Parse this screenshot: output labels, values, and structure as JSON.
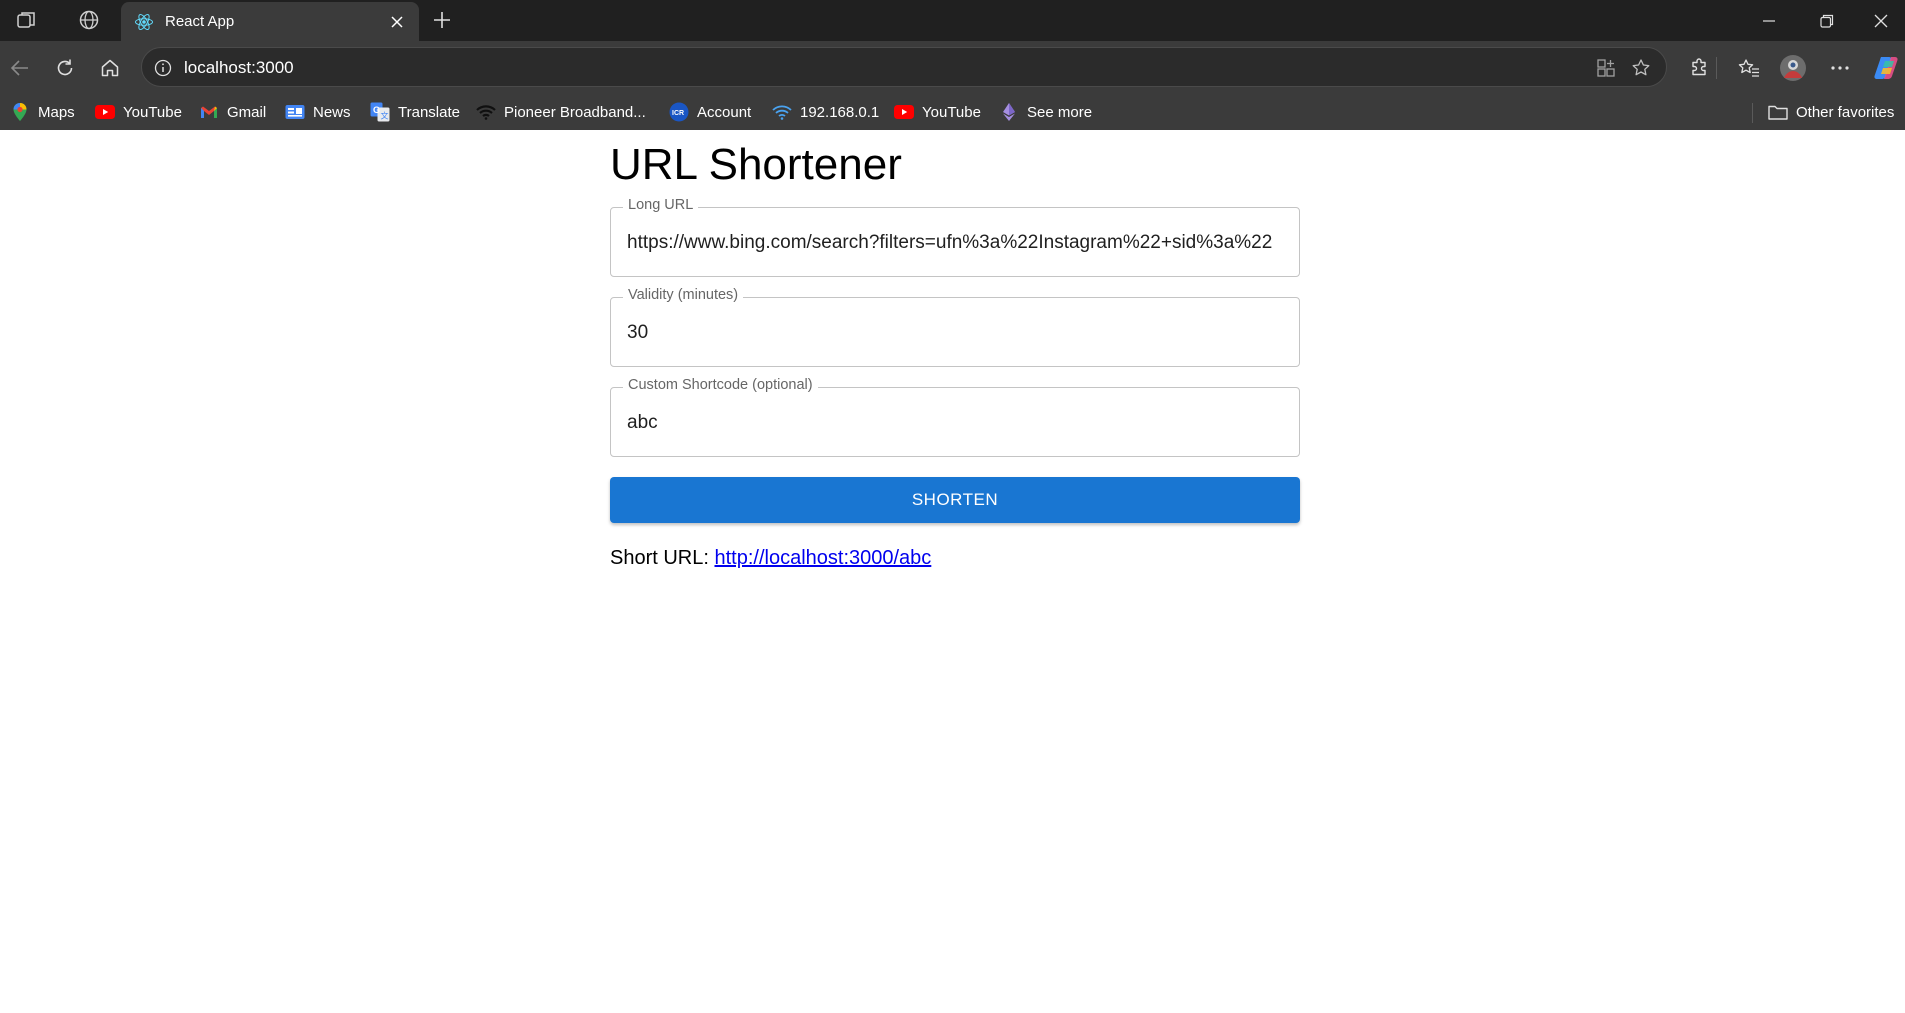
{
  "browser": {
    "tab_title": "React App",
    "address": "localhost:3000",
    "favorites": [
      {
        "label": "Maps",
        "icon": "maps-pin-icon"
      },
      {
        "label": "YouTube",
        "icon": "youtube-icon"
      },
      {
        "label": "Gmail",
        "icon": "gmail-icon"
      },
      {
        "label": "News",
        "icon": "google-news-icon"
      },
      {
        "label": "Translate",
        "icon": "google-translate-icon"
      },
      {
        "label": "Pioneer Broadband...",
        "icon": "wifi-signal-icon"
      },
      {
        "label": "Account",
        "icon": "icr-logo-icon"
      },
      {
        "label": "192.168.0.1",
        "icon": "wifi-icon"
      },
      {
        "label": "YouTube",
        "icon": "youtube-icon"
      },
      {
        "label": "See more",
        "icon": "ethereum-icon"
      }
    ],
    "other_favorites": "Other favorites",
    "colors": {
      "chrome_dark": "#202020",
      "chrome": "#3b3b3b",
      "omnibox": "#2b2b2b"
    }
  },
  "app": {
    "title": "URL Shortener",
    "long_url": {
      "label": "Long URL",
      "value": "https://www.bing.com/search?filters=ufn%3a%22Instagram%22+sid%3a%22"
    },
    "validity": {
      "label": "Validity (minutes)",
      "value": "30"
    },
    "shortcode": {
      "label": "Custom Shortcode (optional)",
      "value": "abc"
    },
    "button_label": "SHORTEN",
    "result_prefix": "Short URL: ",
    "short_url": "http://localhost:3000/abc",
    "colors": {
      "primary": "#1976d2",
      "link": "#0000ee",
      "border": "#c4c4c4",
      "label": "#666666"
    }
  }
}
